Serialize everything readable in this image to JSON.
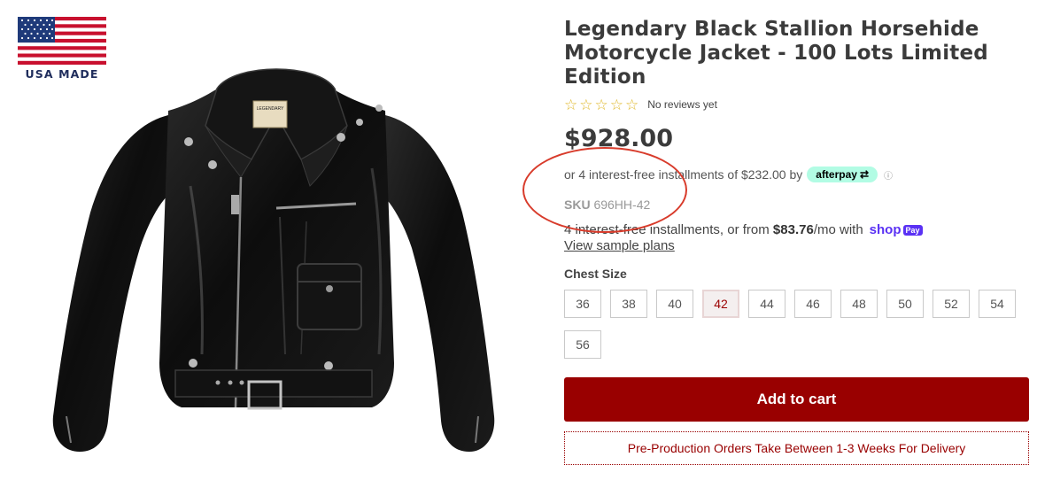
{
  "badge": {
    "label": "USA MADE",
    "icon": "us-flag-icon"
  },
  "product": {
    "title": "Legendary Black Stallion Horsehide Motorcycle Jacket - 100 Lots Limited Edition",
    "rating": {
      "stars": 0,
      "max_stars": 5,
      "reviews_text": "No reviews yet"
    },
    "price": "$928.00",
    "afterpay": {
      "text": "or 4 interest-free installments of $232.00 by",
      "brand": "afterpay",
      "info_icon": "info-icon"
    },
    "sku": {
      "label": "SKU",
      "value": "696HH-42"
    },
    "shop_pay": {
      "text_prefix": "4 interest-free installments, or from",
      "amount": "$83.76",
      "text_suffix": "/mo with",
      "brand": "shop",
      "badge": "Pay",
      "link": "View sample plans"
    },
    "size_label": "Chest Size",
    "sizes": [
      "36",
      "38",
      "40",
      "42",
      "44",
      "46",
      "48",
      "50",
      "52",
      "54",
      "56"
    ],
    "selected_size": "42",
    "add_to_cart": "Add to cart",
    "notice": "Pre-Production Orders Take Between 1-3 Weeks For Delivery",
    "image_label": {
      "brand": "LEGENDARY"
    }
  },
  "colors": {
    "accent": "#990000",
    "star": "#e0b92f",
    "afterpay_bg": "#b2fce4",
    "shop_pay": "#5a31f4",
    "annotation_circle": "#d83b2b"
  }
}
